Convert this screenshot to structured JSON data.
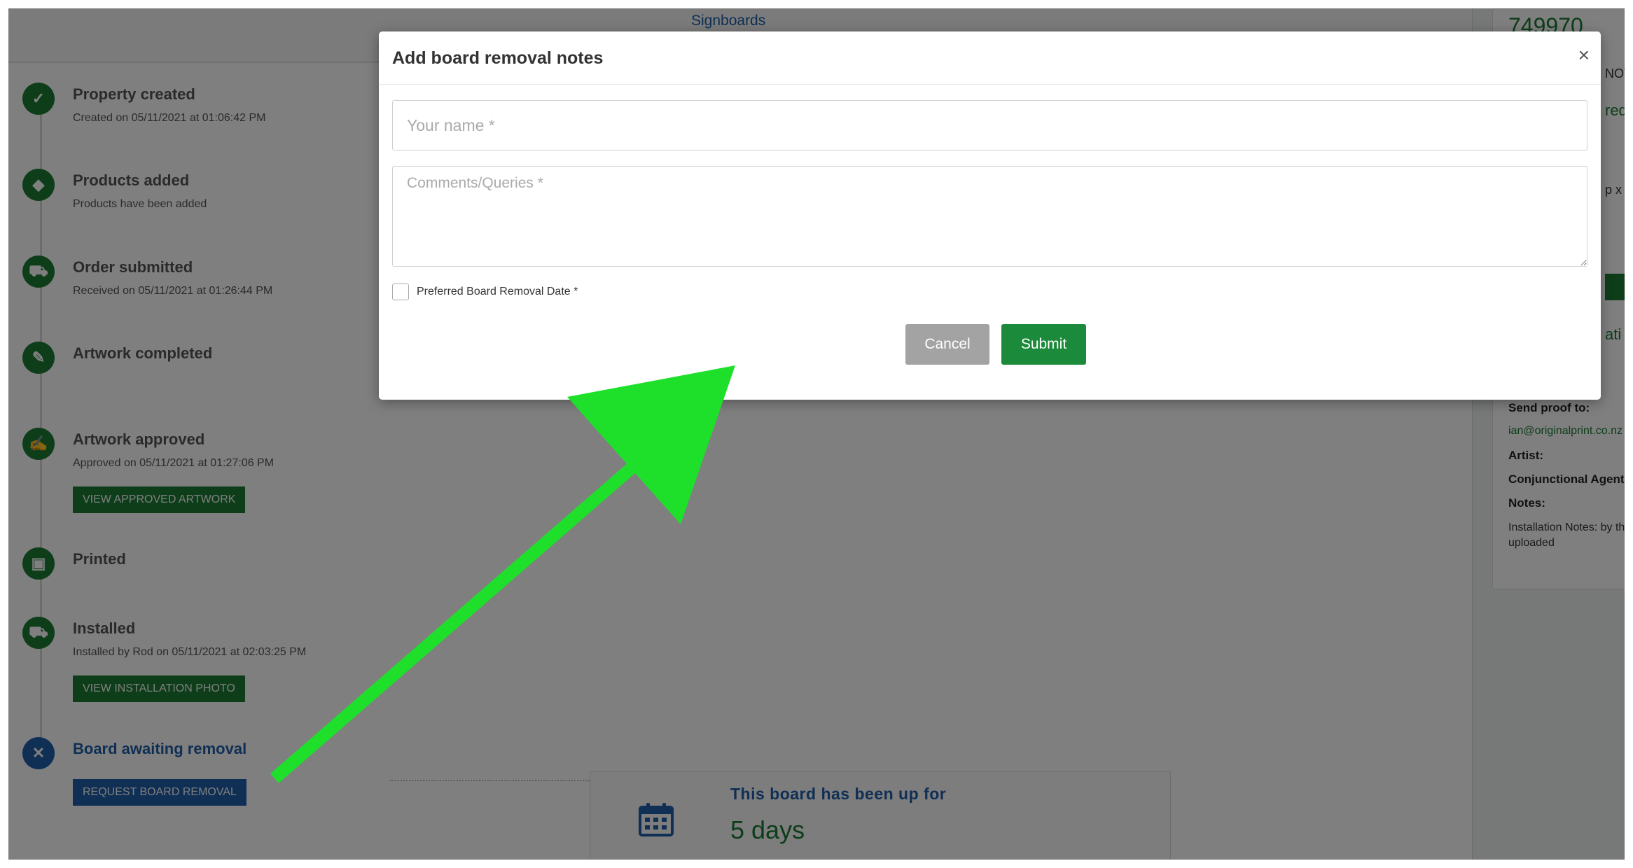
{
  "page": {
    "brand": "Signboards"
  },
  "right_panel": {
    "property_id": "749970",
    "frag_not": "NOT",
    "frag_red": "red",
    "frag_px": "p x",
    "frag_ati": "ati",
    "send_proof_label": "Send proof to:",
    "send_proof_email": "ian@originalprint.co.nz",
    "artist_label": "Artist:",
    "agent_label": "Conjunctional Agent:",
    "notes_label": "Notes:",
    "notes_text_1": "Installation Notes: by th",
    "notes_text_2": "uploaded"
  },
  "timeline": [
    {
      "title": "Property created",
      "sub": "Created on 05/11/2021 at 01:06:42 PM",
      "icon": "check-icon"
    },
    {
      "title": "Products added",
      "sub": "Products have been added",
      "icon": "tag-icon"
    },
    {
      "title": "Order submitted",
      "sub": "Received on 05/11/2021 at 01:26:44 PM",
      "icon": "cart-icon"
    },
    {
      "title": "Artwork completed",
      "sub": "",
      "icon": "brush-icon"
    },
    {
      "title": "Artwork approved",
      "sub": "Approved on 05/11/2021 at 01:27:06 PM",
      "icon": "edit-icon",
      "button": "VIEW APPROVED ARTWORK"
    },
    {
      "title": "Printed",
      "sub": "",
      "icon": "image-icon"
    },
    {
      "title": "Installed",
      "sub": "Installed by Rod on 05/11/2021 at 02:03:25 PM",
      "icon": "truck-icon",
      "button": "VIEW INSTALLATION PHOTO"
    },
    {
      "title": "Board awaiting removal",
      "sub": "",
      "icon": "close-icon",
      "button": "REQUEST BOARD REMOVAL"
    }
  ],
  "board_age": {
    "title": "This board has been up for",
    "days": "5 days"
  },
  "modal": {
    "title": "Add board removal notes",
    "close": "×",
    "name_placeholder": "Your name *",
    "comments_placeholder": "Comments/Queries *",
    "date_label": "Preferred Board Removal Date *",
    "cancel": "Cancel",
    "submit": "Submit"
  },
  "colors": {
    "primary_green": "#1b7a33",
    "primary_blue": "#1f5fa8",
    "overlay": "rgba(0,0,0,0.5)",
    "annotation_arrow": "#1ee02a"
  }
}
